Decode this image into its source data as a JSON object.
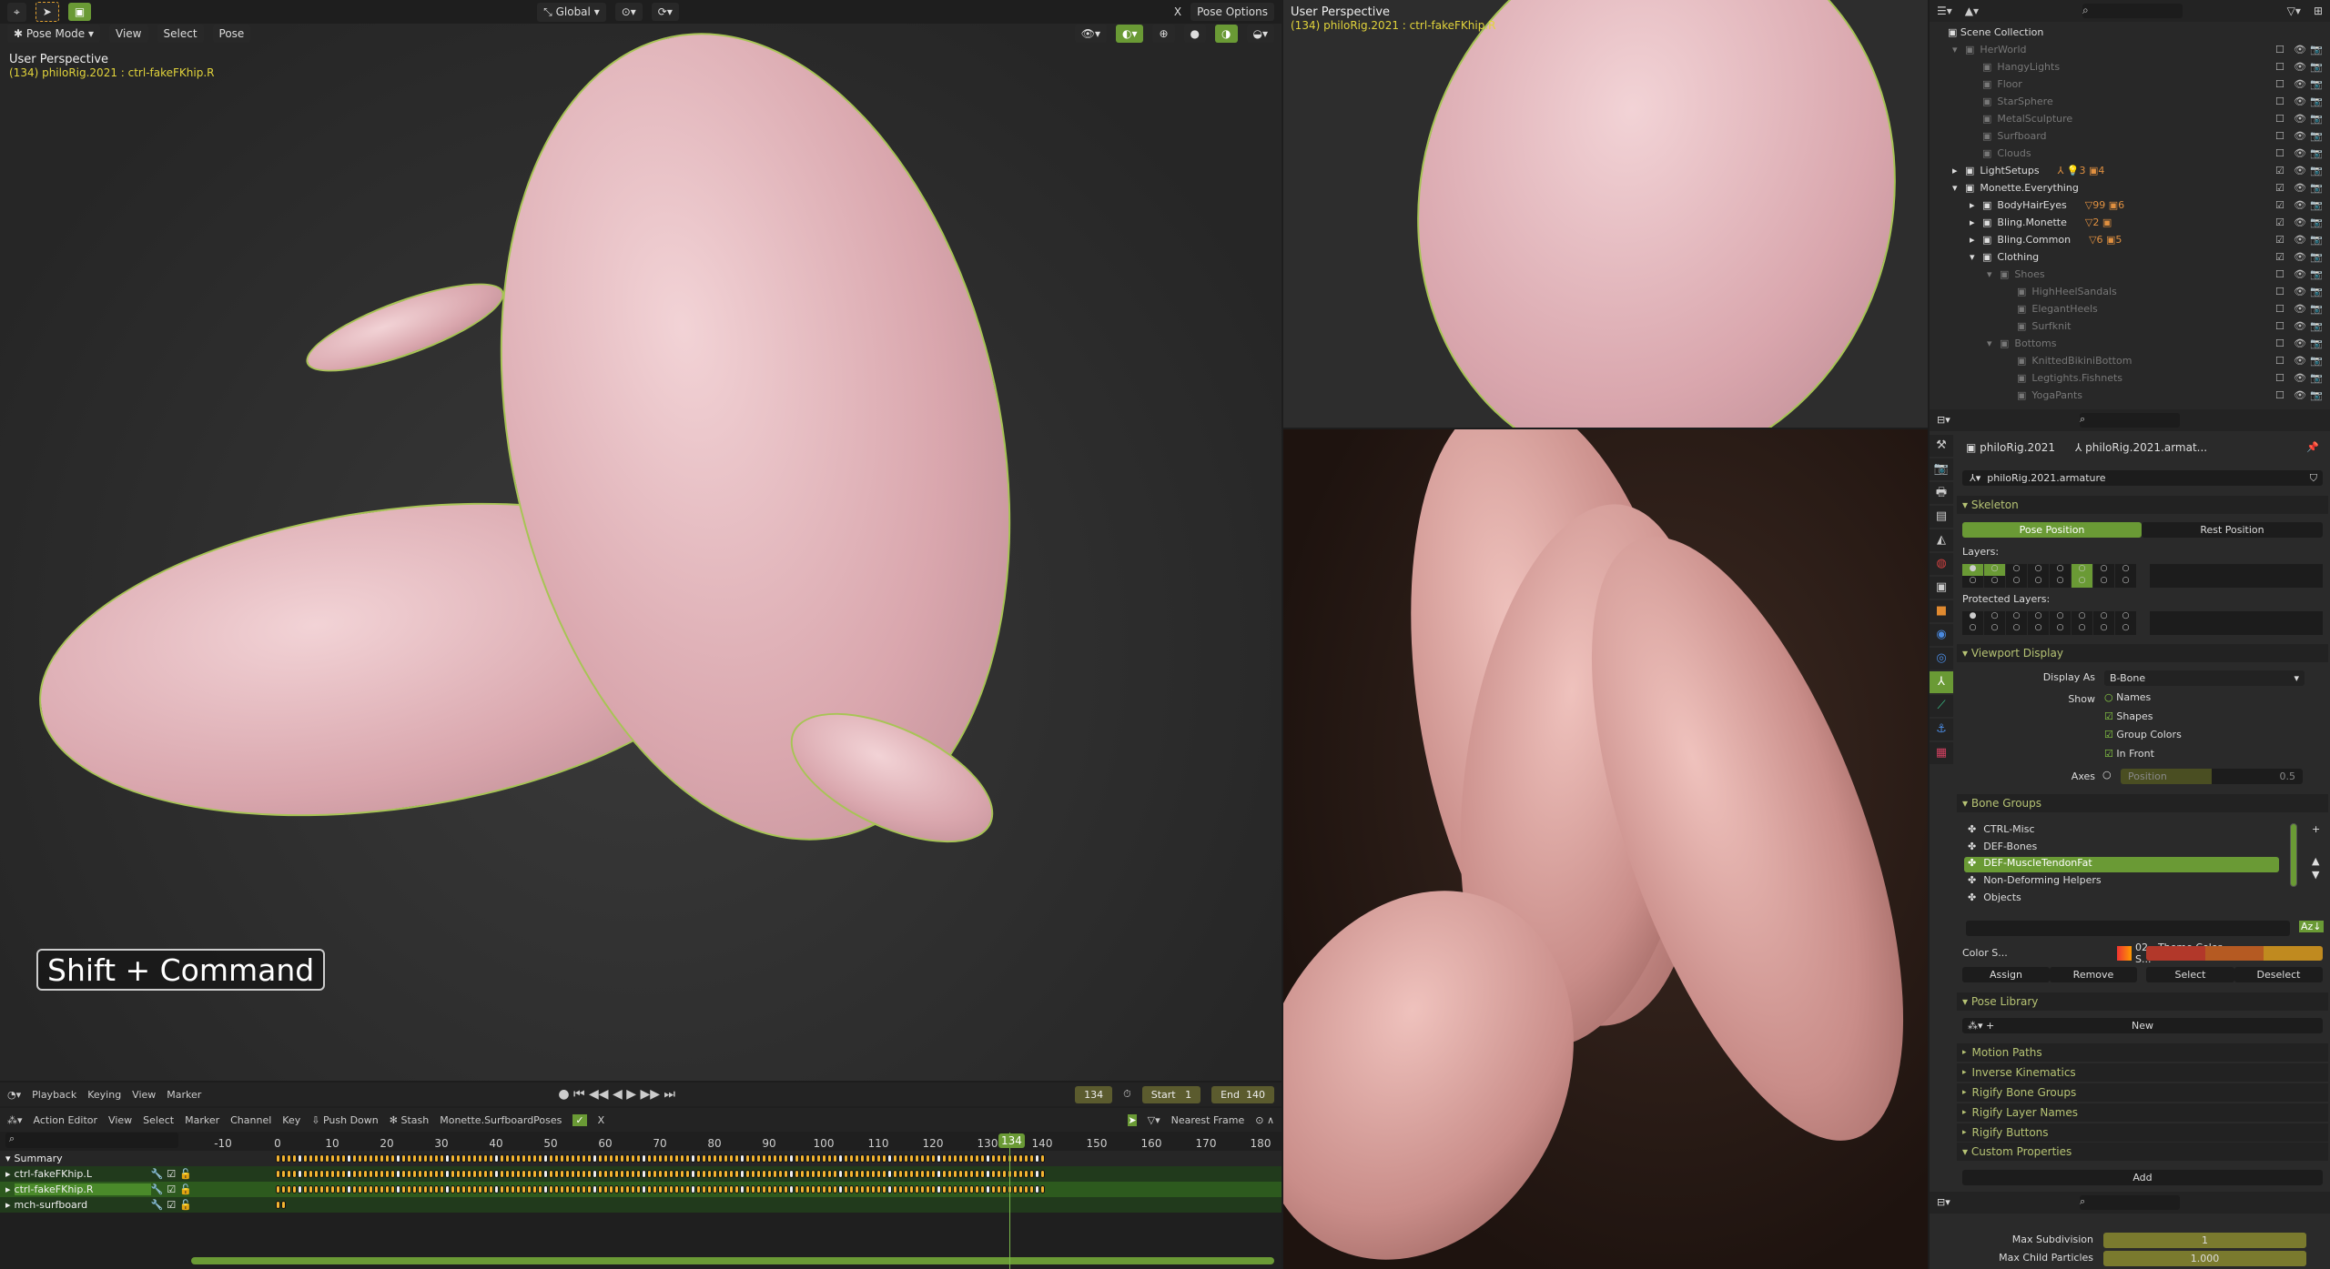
{
  "viewport_main": {
    "mode": "Pose Mode",
    "menus": [
      "View",
      "Select",
      "Pose"
    ],
    "orientation": "Global",
    "options": "Pose Options",
    "x_axis": "X",
    "title": "User Perspective",
    "subtitle": "(134) philoRig.2021 : ctrl-fakeFKhip.R",
    "key_hint": "Shift + Command"
  },
  "viewport_top": {
    "title": "User Perspective",
    "subtitle": "(134) philoRig.2021 : ctrl-fakeFKhip.R"
  },
  "timeline": {
    "menus": [
      "Playback",
      "Keying",
      "View",
      "Marker"
    ],
    "current_frame": "134",
    "start_label": "Start",
    "start": "1",
    "end_label": "End",
    "end": "140",
    "editor": "Action Editor",
    "editor_menus": [
      "View",
      "Select",
      "Marker",
      "Channel",
      "Key"
    ],
    "push_down": "Push Down",
    "stash": "Stash",
    "action": "Monette.SurfboardPoses",
    "close": "X",
    "snap": "Nearest Frame",
    "ruler": [
      "-10",
      "0",
      "10",
      "20",
      "30",
      "40",
      "50",
      "60",
      "70",
      "80",
      "90",
      "100",
      "110",
      "120",
      "130",
      "140",
      "150",
      "160",
      "170",
      "180"
    ],
    "channels": [
      {
        "name": "Summary",
        "first": 0,
        "last": 140
      },
      {
        "name": "ctrl-fakeFKhip.L",
        "first": 0,
        "last": 140
      },
      {
        "name": "ctrl-fakeFKhip.R",
        "first": 0,
        "last": 140,
        "selected": true
      },
      {
        "name": "mch-surfboard",
        "first": 0,
        "last": 1
      }
    ]
  },
  "outliner": {
    "root": "Scene Collection",
    "rows": [
      {
        "name": "HerWorld",
        "level": 0,
        "exp": "▾",
        "on": false
      },
      {
        "name": "HangyLights",
        "level": 1,
        "on": false
      },
      {
        "name": "Floor",
        "level": 1,
        "on": false
      },
      {
        "name": "StarSphere",
        "level": 1,
        "on": false
      },
      {
        "name": "MetalSculpture",
        "level": 1,
        "on": false
      },
      {
        "name": "Surfboard",
        "level": 1,
        "on": false
      },
      {
        "name": "Clouds",
        "level": 1,
        "on": false
      },
      {
        "name": "LightSetups",
        "level": 0,
        "exp": "▸",
        "on": true,
        "badges": "⅄ 💡3 ▣4"
      },
      {
        "name": "Monette.Everything",
        "level": 0,
        "exp": "▾",
        "on": true
      },
      {
        "name": "BodyHairEyes",
        "level": 1,
        "exp": "▸",
        "on": true,
        "badges": "▽99 ▣6"
      },
      {
        "name": "Bling.Monette",
        "level": 1,
        "exp": "▸",
        "on": true,
        "badges": "▽2 ▣"
      },
      {
        "name": "Bling.Common",
        "level": 1,
        "exp": "▸",
        "on": true,
        "badges": "▽6 ▣5"
      },
      {
        "name": "Clothing",
        "level": 1,
        "exp": "▾",
        "on": true
      },
      {
        "name": "Shoes",
        "level": 2,
        "exp": "▾",
        "on": false
      },
      {
        "name": "HighHeelSandals",
        "level": 3,
        "on": false
      },
      {
        "name": "ElegantHeels",
        "level": 3,
        "on": false
      },
      {
        "name": "Surfknit",
        "level": 3,
        "on": false
      },
      {
        "name": "Bottoms",
        "level": 2,
        "exp": "▾",
        "on": false
      },
      {
        "name": "KnittedBikiniBottom",
        "level": 3,
        "on": false
      },
      {
        "name": "Legtights.Fishnets",
        "level": 3,
        "on": false
      },
      {
        "name": "YogaPants",
        "level": 3,
        "on": false
      }
    ]
  },
  "properties": {
    "object": "philoRig.2021",
    "data_short": "philoRig.2021.armat...",
    "data": "philoRig.2021.armature",
    "skeleton": "Skeleton",
    "pose_position": "Pose Position",
    "rest_position": "Rest Position",
    "layers": "Layers:",
    "protected_layers": "Protected Layers:",
    "viewport_display": "Viewport Display",
    "display_as_label": "Display As",
    "display_as": "B-Bone",
    "show_label": "Show",
    "show": [
      {
        "label": "Names",
        "checked": false
      },
      {
        "label": "Shapes",
        "checked": true
      },
      {
        "label": "Group Colors",
        "checked": true
      },
      {
        "label": "In Front",
        "checked": true
      }
    ],
    "axes_label": "Axes",
    "axes_field": "Position",
    "axes_value": "0.5",
    "bone_groups": "Bone Groups",
    "groups": [
      "CTRL-Misc",
      "DEF-Bones",
      "DEF-MuscleTendonFat",
      "Non-Deforming Helpers",
      "Objects"
    ],
    "active_group": 2,
    "color_set_label": "Color S...",
    "color_set": "02 - Theme Color S...",
    "colors": [
      "#b2382a",
      "#b55a22",
      "#c08a1f"
    ],
    "assign": "Assign",
    "remove": "Remove",
    "select": "Select",
    "deselect": "Deselect",
    "pose_library": "Pose Library",
    "new": "New",
    "collapsed": [
      "Motion Paths",
      "Inverse Kinematics",
      "Rigify Bone Groups",
      "Rigify Layer Names",
      "Rigify Buttons"
    ],
    "custom_properties": "Custom Properties",
    "add": "Add"
  },
  "properties2": {
    "max_subdivision_label": "Max Subdivision",
    "max_subdivision": "1",
    "max_child_label": "Max Child Particles",
    "max_child": "1.000"
  },
  "accent": "#6a9a35"
}
